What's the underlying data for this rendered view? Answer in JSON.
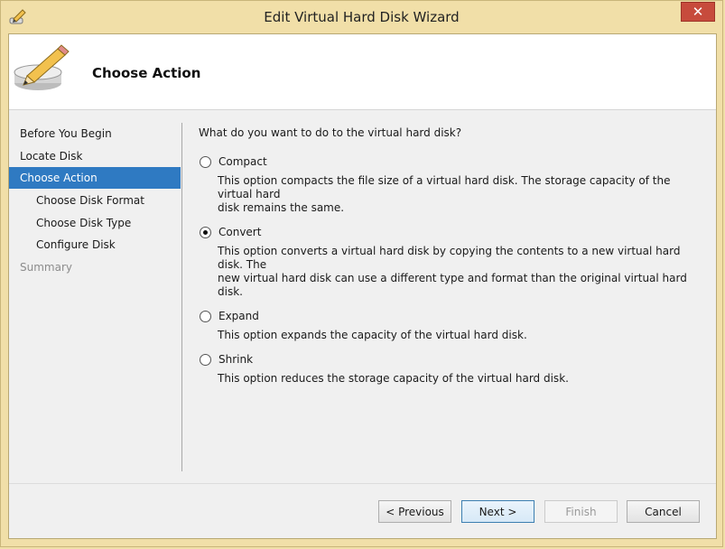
{
  "window": {
    "title": "Edit Virtual Hard Disk Wizard",
    "close_symbol": "✕"
  },
  "header": {
    "title": "Choose Action",
    "icon": "pencil-disk-icon"
  },
  "nav": {
    "items": [
      {
        "label": "Before You Begin",
        "state": "normal"
      },
      {
        "label": "Locate Disk",
        "state": "normal"
      },
      {
        "label": "Choose Action",
        "state": "active"
      },
      {
        "label": "Choose Disk Format",
        "state": "normal"
      },
      {
        "label": "Choose Disk Type",
        "state": "normal"
      },
      {
        "label": "Configure Disk",
        "state": "normal"
      },
      {
        "label": "Summary",
        "state": "disabled"
      }
    ]
  },
  "content": {
    "question": "What do you want to do to the virtual hard disk?",
    "selected": "Convert",
    "options": [
      {
        "label": "Compact",
        "desc1": "This option compacts the file size of a virtual hard disk. The storage capacity of the virtual hard",
        "desc2": "disk remains the same."
      },
      {
        "label": "Convert",
        "desc1": "This option converts a virtual hard disk by copying the contents to a new virtual hard disk. The",
        "desc2": "new virtual hard disk can use a different type and format than the original virtual hard disk."
      },
      {
        "label": "Expand",
        "desc1": "This option expands the capacity of the virtual hard disk.",
        "desc2": ""
      },
      {
        "label": "Shrink",
        "desc1": "This option reduces the storage capacity of the virtual hard disk.",
        "desc2": ""
      }
    ]
  },
  "buttons": {
    "previous": "< Previous",
    "next": "Next >",
    "finish": "Finish",
    "cancel": "Cancel"
  },
  "colors": {
    "accent": "#2f7ac2",
    "frame": "#f1dfa8",
    "close": "#c74b3c"
  }
}
